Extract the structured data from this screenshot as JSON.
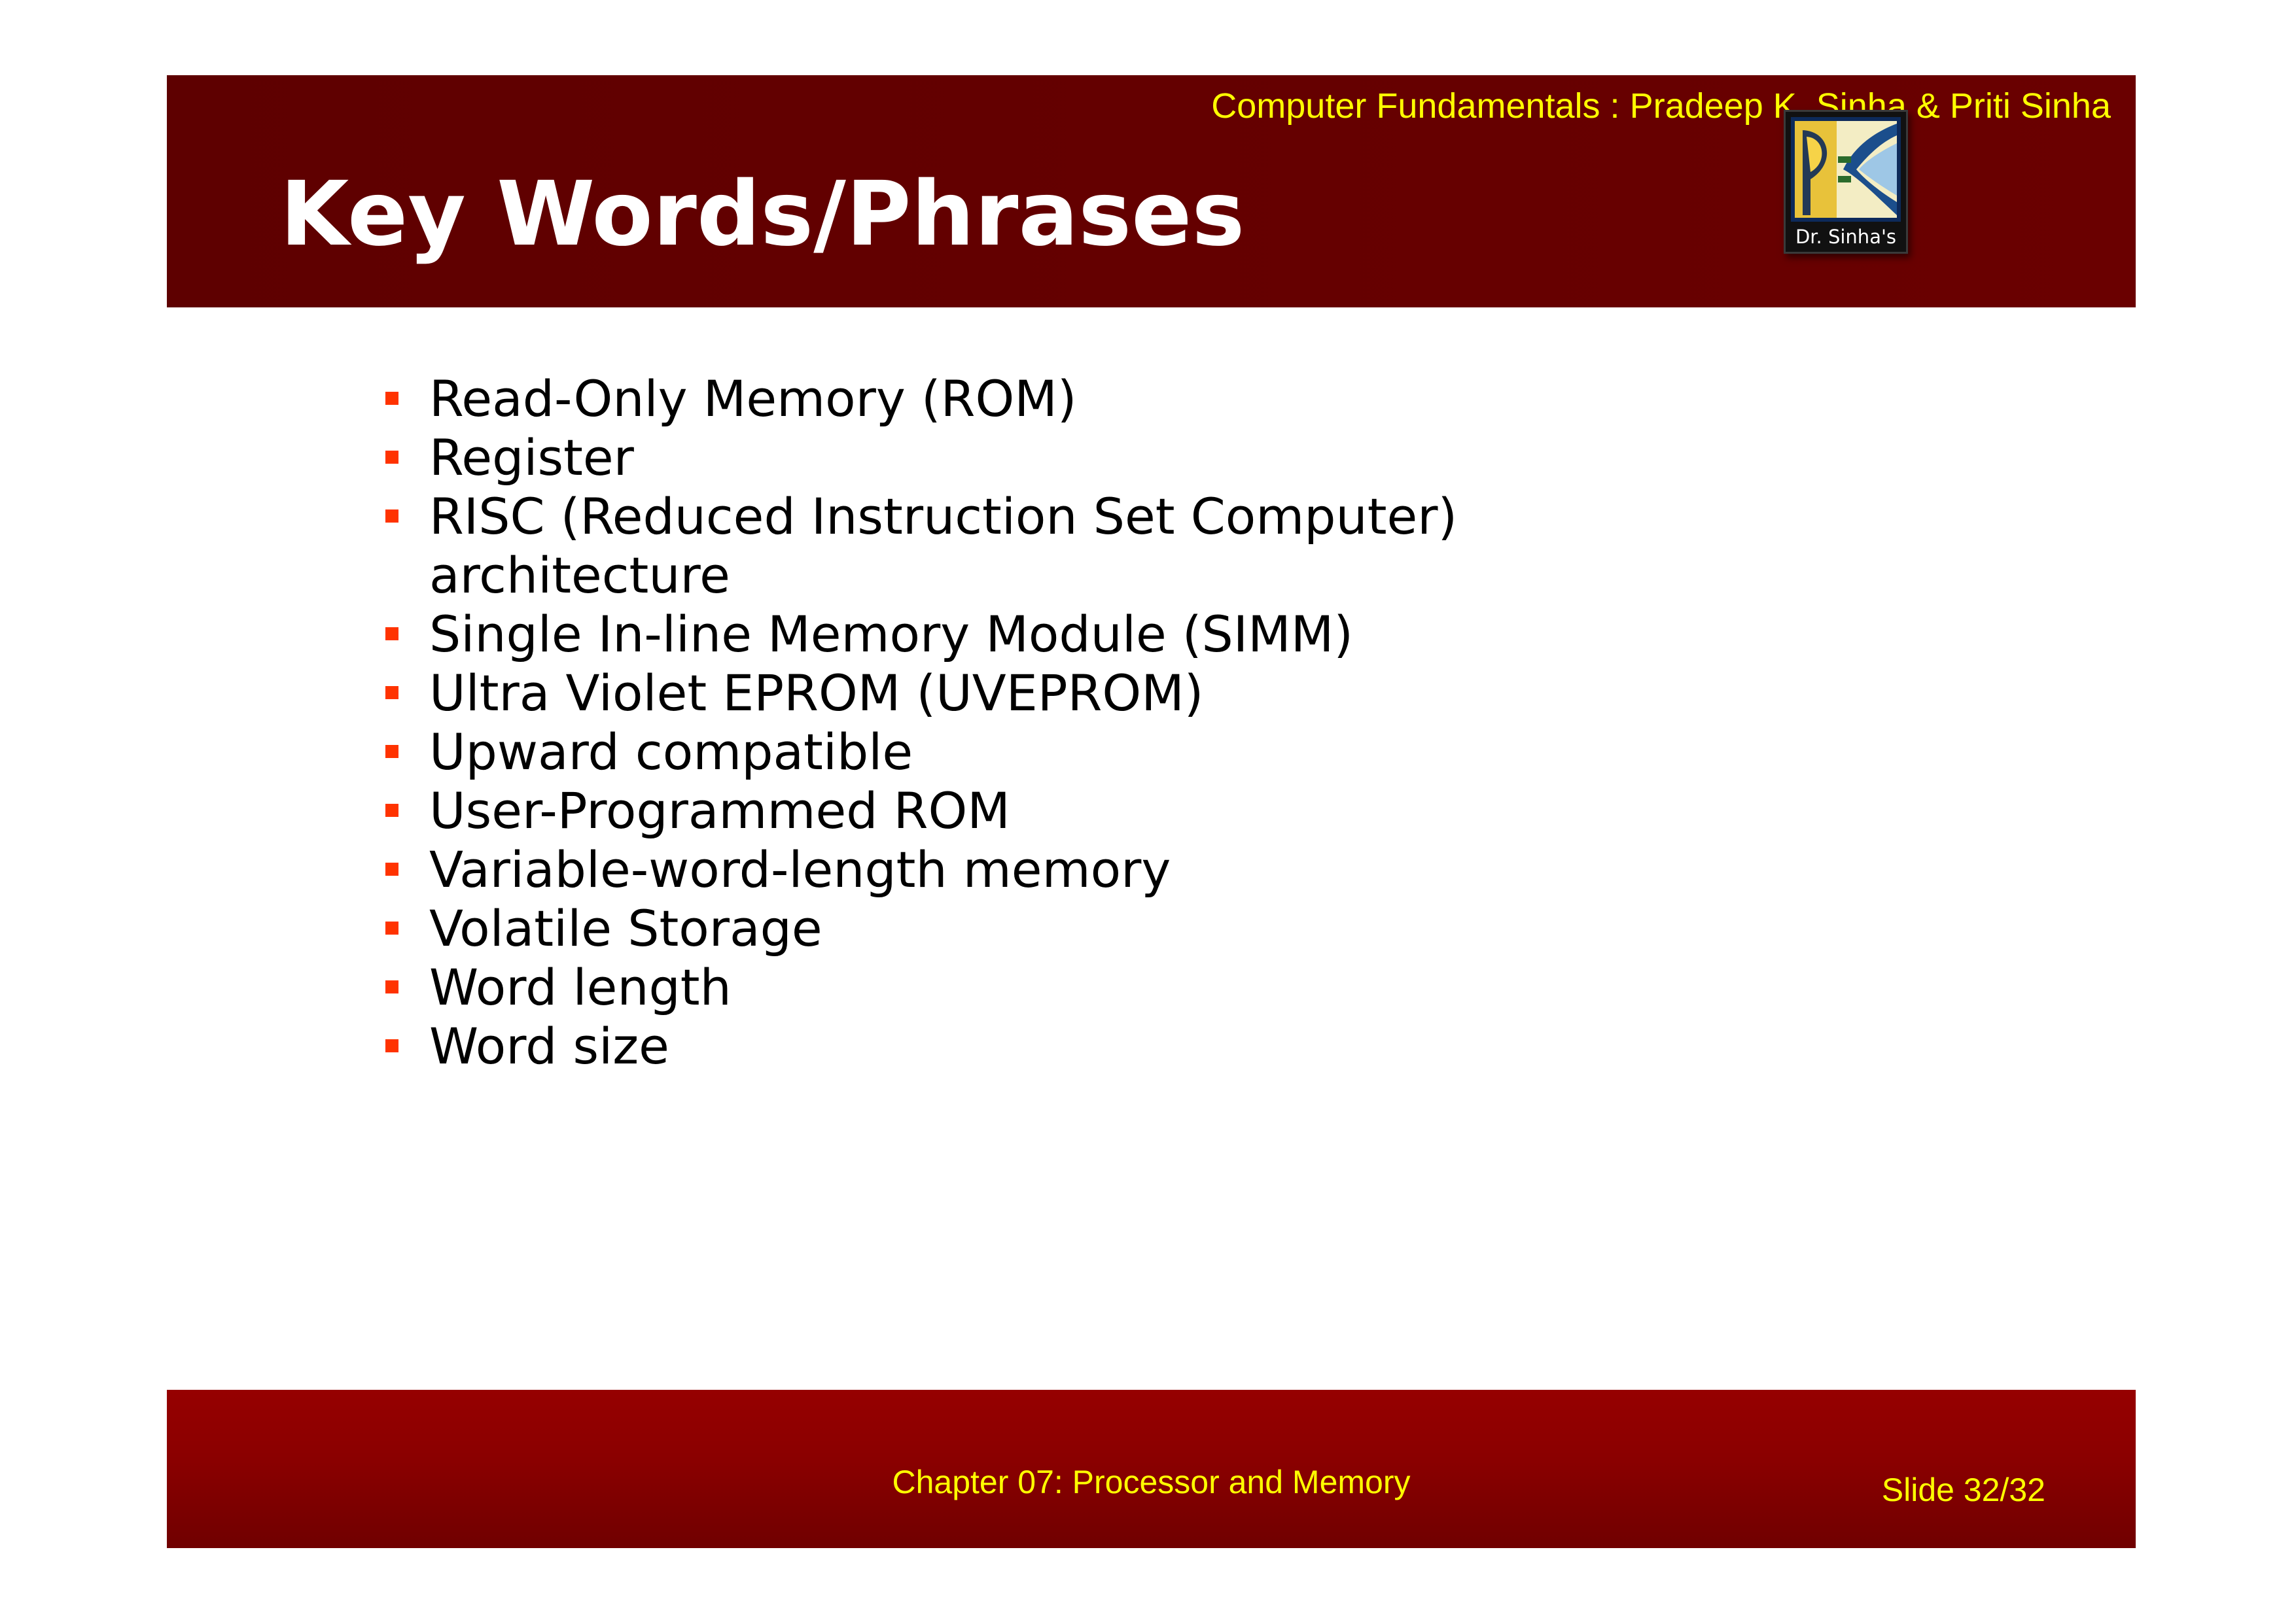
{
  "header": {
    "book_credit": "Computer Fundamentals : Pradeep K. Sinha & Priti Sinha",
    "title": "Key Words/Phrases",
    "logo_text": "Dr. Sinha's"
  },
  "keywords": [
    "Read-Only Memory (ROM)",
    "Register",
    "RISC (Reduced Instruction Set Computer)\narchitecture",
    "Single In-line Memory Module (SIMM)",
    "Ultra Violet EPROM (UVEPROM)",
    "Upward compatible",
    "User-Programmed ROM",
    "Variable-word-length memory",
    "Volatile Storage",
    "Word length",
    "Word size"
  ],
  "footer": {
    "chapter": "Chapter 07: Processor and Memory",
    "slide": "Slide 32/32"
  },
  "colors": {
    "header_band": "#640000",
    "footer_band": "#8a0000",
    "accent_text": "#ffff00",
    "bullet": "#ff3300"
  }
}
